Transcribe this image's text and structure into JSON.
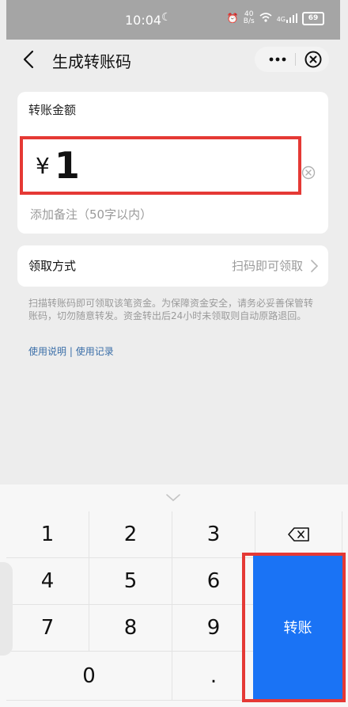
{
  "status_bar": {
    "time": "10:04",
    "speed_top": "40",
    "speed_unit": "B/s",
    "network": "4G",
    "battery": "69"
  },
  "nav": {
    "title": "生成转账码",
    "more_label": "•••"
  },
  "amount_card": {
    "label": "转账金额",
    "currency": "¥",
    "amount": "1",
    "remark_placeholder": "添加备注（50字以内）"
  },
  "method": {
    "label": "领取方式",
    "value": "扫码即可领取"
  },
  "notice": {
    "text": "扫描转账码即可领取该笔资金。为保障资金安全，请务必妥善保管转账码，切勿随意转发。资金转出后24小时未领取则自动原路退回。"
  },
  "links": {
    "instructions": "使用说明",
    "separator": " | ",
    "records": "使用记录"
  },
  "keyboard": {
    "keys": [
      "1",
      "2",
      "3",
      "4",
      "5",
      "6",
      "7",
      "8",
      "9",
      "0",
      "."
    ],
    "transfer_label": "转账"
  },
  "colors": {
    "accent": "#1a73f5",
    "highlight": "#e53935"
  }
}
